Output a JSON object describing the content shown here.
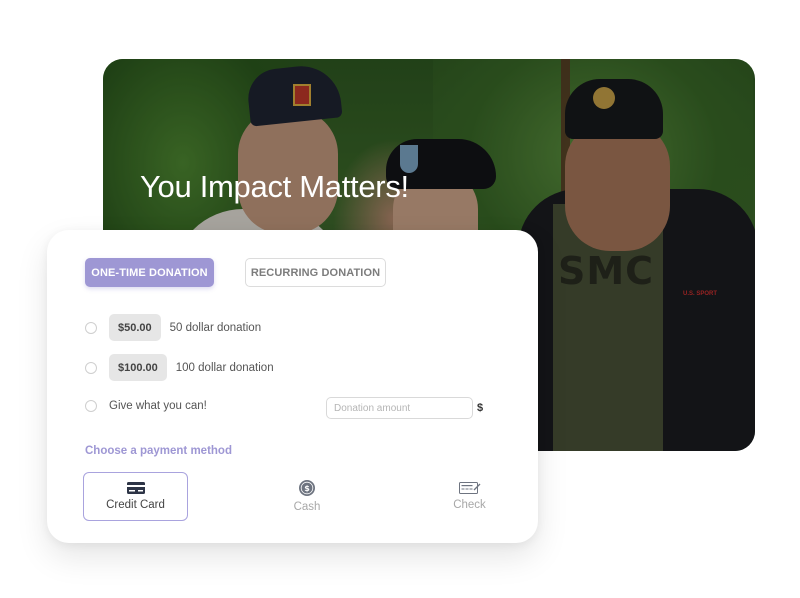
{
  "hero": {
    "title": "You Impact Matters!",
    "image_description": "three smiling military veterans wearing caps and beret outdoors",
    "shirt_text": "SMC",
    "jacket_logo": "U.S. SPORT"
  },
  "donation_type_tabs": {
    "one_time": "ONE-TIME DONATION",
    "recurring": "RECURRING DONATION",
    "selected": "one_time"
  },
  "options": [
    {
      "amount": "$50.00",
      "description": "50 dollar donation",
      "selected": false
    },
    {
      "amount": "$100.00",
      "description": "100 dollar donation",
      "selected": false
    }
  ],
  "custom_option": {
    "label": "Give what you can!",
    "input_placeholder": "Donation amount",
    "input_value": "",
    "currency_symbol": "$",
    "selected": false
  },
  "payment": {
    "heading": "Choose a payment method",
    "methods": [
      {
        "label": "Credit Card",
        "icon": "credit-card-icon",
        "selected": true
      },
      {
        "label": "Cash",
        "icon": "dollar-coin-icon",
        "selected": false
      },
      {
        "label": "Check",
        "icon": "check-cheque-icon",
        "selected": false
      }
    ]
  },
  "colors": {
    "accent": "#9e97d4",
    "accent_border": "#a9a3de",
    "amount_chip_bg": "#e6e6e6",
    "muted_text": "#a8a8a8",
    "icon_dark": "#2d3446",
    "icon_grey": "#6e7480"
  }
}
